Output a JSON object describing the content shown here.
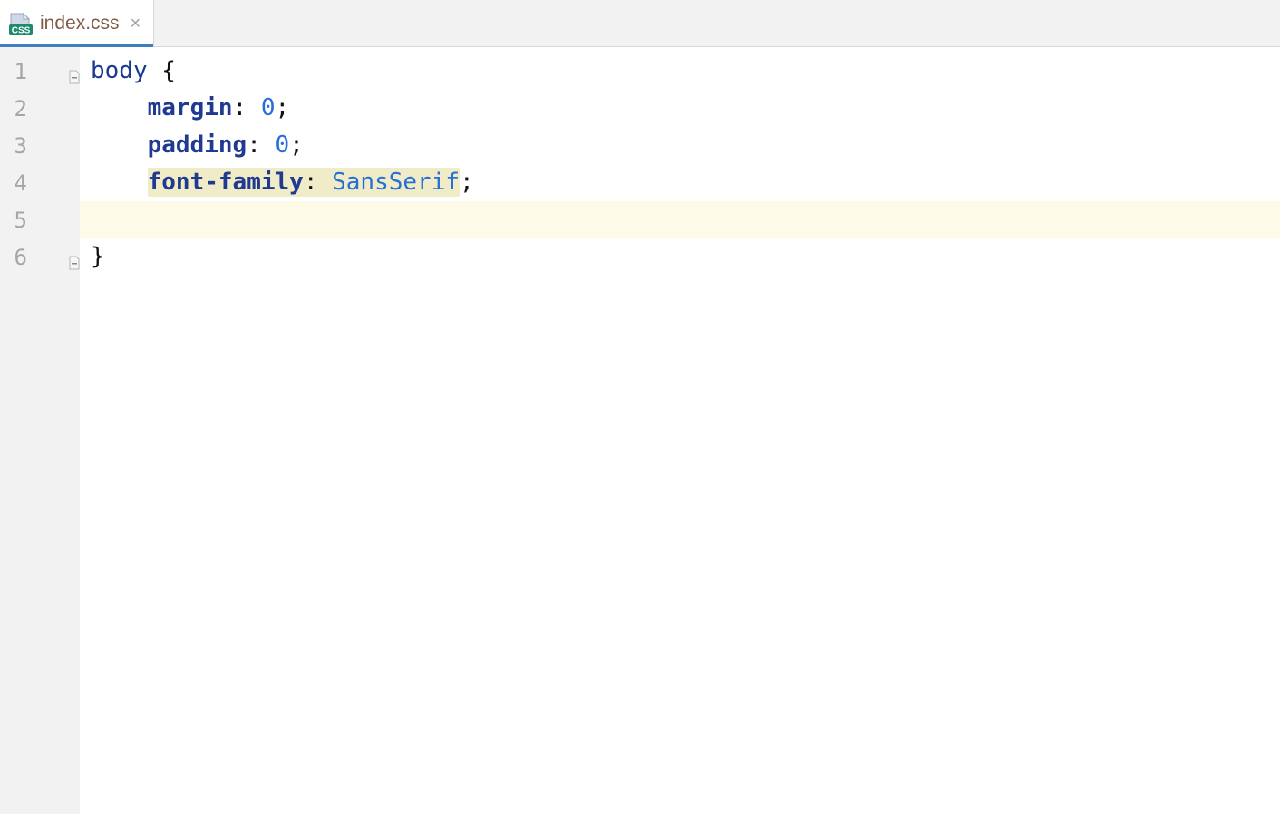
{
  "tab": {
    "filename": "index.css",
    "icon_badge": "CSS"
  },
  "current_line": 5,
  "lines": [
    {
      "n": 1,
      "fold": "open-start",
      "tokens": [
        {
          "t": "body",
          "c": "tok-selector"
        },
        {
          "t": " ",
          "c": ""
        },
        {
          "t": "{",
          "c": "tok-brace"
        }
      ]
    },
    {
      "n": 2,
      "indent": "    ",
      "tokens": [
        {
          "t": "margin",
          "c": "tok-prop"
        },
        {
          "t": ":",
          "c": "tok-colon"
        },
        {
          "t": " ",
          "c": ""
        },
        {
          "t": "0",
          "c": "tok-num"
        },
        {
          "t": ";",
          "c": "tok-semi"
        }
      ]
    },
    {
      "n": 3,
      "indent": "    ",
      "tokens": [
        {
          "t": "padding",
          "c": "tok-prop"
        },
        {
          "t": ":",
          "c": "tok-colon"
        },
        {
          "t": " ",
          "c": ""
        },
        {
          "t": "0",
          "c": "tok-num"
        },
        {
          "t": ";",
          "c": "tok-semi"
        }
      ]
    },
    {
      "n": 4,
      "indent": "    ",
      "hl_prop": true,
      "tokens": [
        {
          "t": "font-family",
          "c": "tok-prop"
        },
        {
          "t": ":",
          "c": "tok-colon"
        },
        {
          "t": " ",
          "c": ""
        },
        {
          "t": "SansSerif",
          "c": "tok-val"
        },
        {
          "t": ";",
          "c": "tok-semi"
        }
      ]
    },
    {
      "n": 5,
      "indent": "",
      "tokens": []
    },
    {
      "n": 6,
      "fold": "open-end",
      "tokens": [
        {
          "t": "}",
          "c": "tok-brace"
        }
      ]
    }
  ]
}
